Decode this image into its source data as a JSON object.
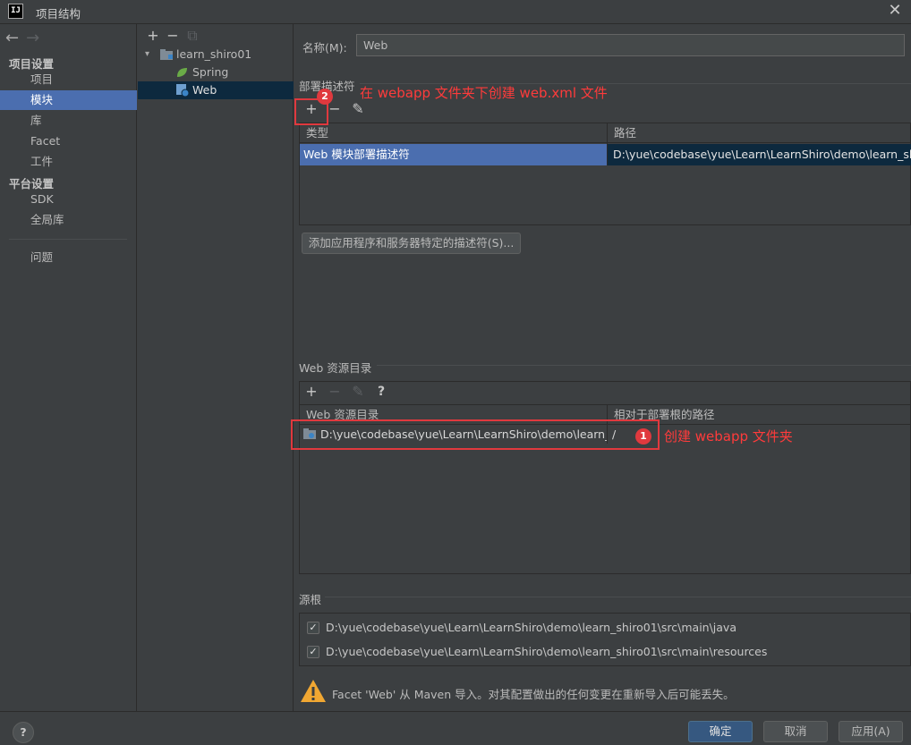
{
  "window": {
    "title": "项目结构",
    "app_icon": "IJ",
    "close": "✕"
  },
  "nav": {
    "back": "←",
    "forward": "→",
    "project_settings_header": "项目设置",
    "project_settings_items": [
      "项目",
      "模块",
      "库",
      "Facet",
      "工件"
    ],
    "platform_settings_header": "平台设置",
    "platform_settings_items": [
      "SDK",
      "全局库"
    ],
    "problems": "问题",
    "selected": "模块"
  },
  "tree": {
    "tools": {
      "add": "+",
      "remove": "−",
      "copy": "⧉"
    },
    "module": "learn_shiro01",
    "children": [
      "Spring",
      "Web"
    ],
    "selected": "Web"
  },
  "facet": {
    "name_label": "名称(M):",
    "name_value": "Web",
    "deployment_descriptors": {
      "title": "部署描述符",
      "tools": {
        "add": "+",
        "remove": "−",
        "edit": "✎"
      },
      "columns": [
        "类型",
        "路径"
      ],
      "rows": [
        {
          "type": "Web 模块部署描述符",
          "path": "D:\\yue\\codebase\\yue\\Learn\\LearnShiro\\demo\\learn_shiro"
        }
      ],
      "add_server_button": "添加应用程序和服务器特定的描述符(S)..."
    },
    "web_resources": {
      "title": "Web 资源目录",
      "tools": {
        "add": "+",
        "remove": "−",
        "edit": "✎",
        "help": "?"
      },
      "columns": [
        "Web 资源目录",
        "相对于部署根的路径"
      ],
      "rows": [
        {
          "dir": "D:\\yue\\codebase\\yue\\Learn\\LearnShiro\\demo\\learn_...",
          "relative": "/"
        }
      ]
    },
    "source_roots": {
      "title": "源根",
      "items": [
        {
          "checked": true,
          "path": "D:\\yue\\codebase\\yue\\Learn\\LearnShiro\\demo\\learn_shiro01\\src\\main\\java"
        },
        {
          "checked": true,
          "path": "D:\\yue\\codebase\\yue\\Learn\\LearnShiro\\demo\\learn_shiro01\\src\\main\\resources"
        }
      ]
    },
    "warning": "Facet 'Web' 从 Maven 导入。对其配置做出的任何变更在重新导入后可能丢失。"
  },
  "footer": {
    "help": "?",
    "ok": "确定",
    "cancel": "取消",
    "apply": "应用(A)"
  },
  "annotations": {
    "step1_badge": "1",
    "step1_text": "创建 webapp 文件夹",
    "step2_badge": "2",
    "step2_text": "在 webapp 文件夹下创建 web.xml 文件"
  },
  "colors": {
    "accent": "#4b6eaf",
    "annotation_red": "#e0393e",
    "background": "#3c3f41"
  }
}
